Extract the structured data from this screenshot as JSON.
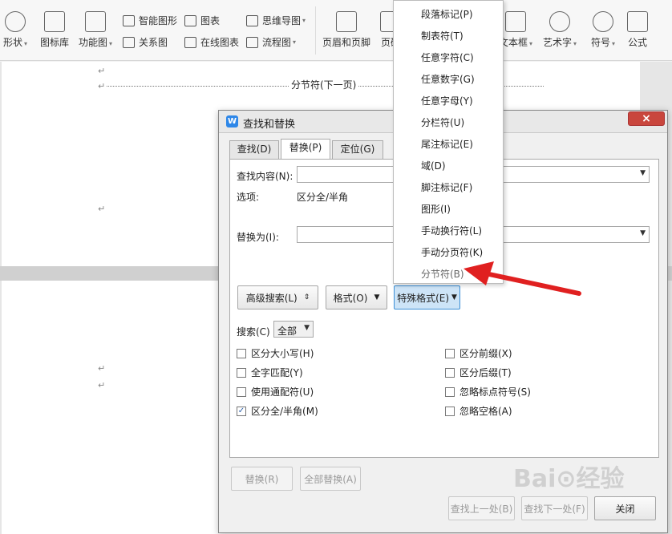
{
  "ribbon": {
    "shapes": "形状",
    "icon_lib": "图标库",
    "func_chart": "功能图",
    "smart_art": "智能图形",
    "chart": "图表",
    "mind_map": "思维导图",
    "relation": "关系图",
    "online_chart": "在线图表",
    "flow_chart": "流程图",
    "header_footer": "页眉和页脚",
    "page_num_partial": "页码",
    "textbox": "文本框",
    "wordart": "艺术字",
    "symbol": "符号",
    "formula": "公式"
  },
  "document": {
    "section_break": "分节符(下一页)",
    "paragraph_mark": "↵"
  },
  "dialog": {
    "title": "查找和替换",
    "tabs": [
      "查找(D)",
      "替换(P)",
      "定位(G)"
    ],
    "find_label": "查找内容(N):",
    "find_value": "",
    "options_label": "选项:",
    "options_value": "区分全/半角",
    "replace_label": "替换为(I):",
    "replace_value": "",
    "adv_search": "高级搜索(L)",
    "format": "格式(O)",
    "special": "特殊格式(E)",
    "search_label": "搜索(C)",
    "search_value": "全部",
    "checks_left": [
      {
        "label": "区分大小写(H)",
        "checked": false
      },
      {
        "label": "全字匹配(Y)",
        "checked": false
      },
      {
        "label": "使用通配符(U)",
        "checked": false
      },
      {
        "label": "区分全/半角(M)",
        "checked": true
      }
    ],
    "checks_right": [
      {
        "label": "区分前缀(X)",
        "checked": false
      },
      {
        "label": "区分后缀(T)",
        "checked": false
      },
      {
        "label": "忽略标点符号(S)",
        "checked": false
      },
      {
        "label": "忽略空格(A)",
        "checked": false
      }
    ],
    "replace_btn": "替换(R)",
    "replace_all_btn": "全部替换(A)",
    "find_prev": "查找上一处(B)",
    "find_next": "查找下一处(F)",
    "close": "关闭"
  },
  "menu": {
    "items": [
      "段落标记(P)",
      "制表符(T)",
      "任意字符(C)",
      "任意数字(G)",
      "任意字母(Y)",
      "分栏符(U)",
      "尾注标记(E)",
      "域(D)",
      "脚注标记(F)",
      "图形(I)",
      "手动换行符(L)",
      "手动分页符(K)",
      "分节符(B)"
    ]
  },
  "annotation_color": "#e02020"
}
